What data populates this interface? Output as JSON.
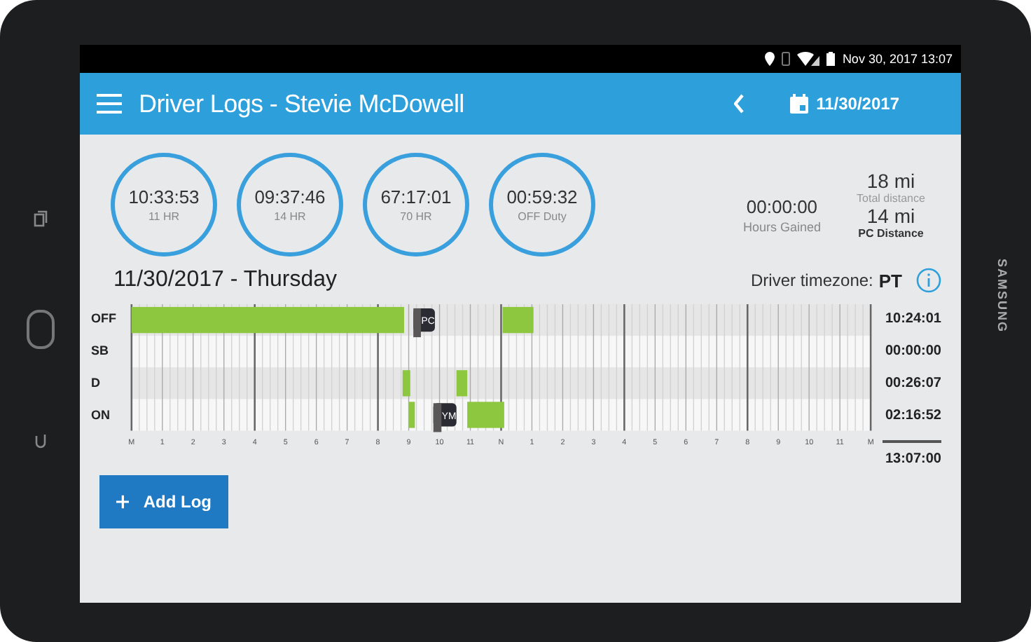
{
  "device": {
    "brand": "SAMSUNG"
  },
  "status_bar": {
    "datetime": "Nov 30, 2017 13:07"
  },
  "app_bar": {
    "title": "Driver Logs - Stevie McDowell",
    "date": "11/30/2017"
  },
  "clocks": [
    {
      "time": "10:33:53",
      "label": "11 HR"
    },
    {
      "time": "09:37:46",
      "label": "14 HR"
    },
    {
      "time": "67:17:01",
      "label": "70 HR"
    },
    {
      "time": "00:59:32",
      "label": "OFF Duty"
    }
  ],
  "hours_gained": {
    "value": "00:00:00",
    "label": "Hours Gained"
  },
  "distances": [
    {
      "kind": "total",
      "value": "18 mi",
      "label": "Total distance"
    },
    {
      "kind": "pc",
      "value": "14 mi",
      "label": "PC Distance"
    }
  ],
  "day_title": "11/30/2017 - Thursday",
  "timezone": {
    "label": "Driver timezone:",
    "value": "PT"
  },
  "log": {
    "hour_labels": [
      "M",
      "1",
      "2",
      "3",
      "4",
      "5",
      "6",
      "7",
      "8",
      "9",
      "10",
      "11",
      "N",
      "1",
      "2",
      "3",
      "4",
      "5",
      "6",
      "7",
      "8",
      "9",
      "10",
      "11",
      "M"
    ],
    "rows": [
      {
        "label": "OFF",
        "total": "10:24:01"
      },
      {
        "label": "SB",
        "total": "00:00:00"
      },
      {
        "label": "D",
        "total": "00:26:07"
      },
      {
        "label": "ON",
        "total": "02:16:52"
      }
    ],
    "markers": [
      "PC",
      "YM"
    ],
    "grand_total": "13:07:00"
  },
  "add_button": {
    "label": "Add Log"
  }
}
